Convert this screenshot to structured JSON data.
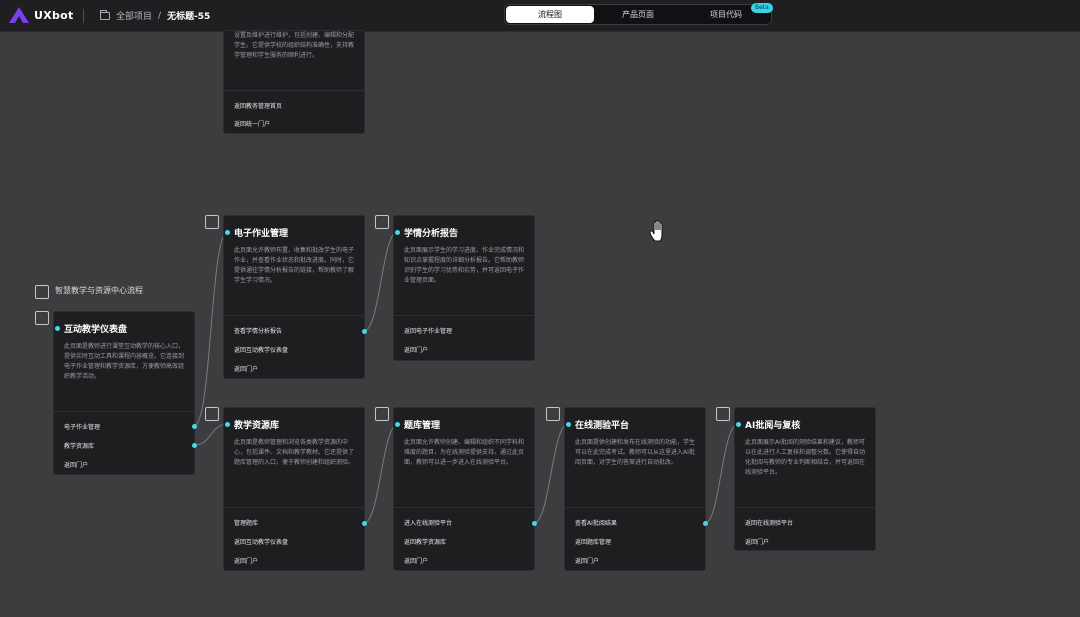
{
  "app": {
    "logo_text": "UXbot",
    "breadcrumb_root": "全部项目",
    "breadcrumb_sep": "/",
    "breadcrumb_current": "无标题-55"
  },
  "tabs": [
    {
      "label": "流程图",
      "active": true
    },
    {
      "label": "产品页面"
    },
    {
      "label": "项目代码"
    }
  ],
  "beta": "Beta",
  "flow_label": "智慧教学与资源中心流程",
  "colors": {
    "accent": "#46d7ef",
    "bg": "#3d3d3f",
    "node": "#1e1e21"
  },
  "nodes": {
    "top": {
      "desc": "设置及维护进行维护，包括创建、编辑和分配学生。它提供学校的组织结构准确性，支持教学管理和学生服务的顺利进行。",
      "links": [
        "返回教务管理首页",
        "返回统一门户"
      ]
    },
    "dashboard": {
      "title": "互动教学仪表盘",
      "desc": "此页面是教师进行课堂互动教学的核心入口，提供实时互动工具和课程内容概览。它连接到电子作业管理和教学资源库，方便教师高效组织教学活动。",
      "links": [
        "电子作业管理",
        "教学资源库",
        "返回门户"
      ]
    },
    "homework": {
      "title": "电子作业管理",
      "desc": "此页面允许教师布置、收集和批改学生的电子作业，并查看作业状态和批改进度。同时，它提供通往学情分析报告的链接，帮助教师了解学生学习情况。",
      "links": [
        "查看学情分析报告",
        "返回互动教学仪表盘",
        "返回门户"
      ]
    },
    "analysis": {
      "title": "学情分析报告",
      "desc": "此页面展示学生的学习进度、作业完成情况和知识点掌握程度的详细分析报告。它帮助教师识别学生的学习优势和劣势，并可返回电子作业管理页面。",
      "links": [
        "返回电子作业管理",
        "返回门户"
      ]
    },
    "resources": {
      "title": "教学资源库",
      "desc": "此页面是教师管理和浏览各类教学资源的中心，包括课件、文档和教学教材。它还提供了题库管理的入口，便于教师创建和组织测验。",
      "links": [
        "管理题库",
        "返回互动教学仪表盘",
        "返回门户"
      ]
    },
    "questions": {
      "title": "题库管理",
      "desc": "此页面允许教师创建、编辑和组织不同学科和难度的题目，为在线测验提供支持。通过此页面，教师可以进一步进入在线测验平台。",
      "links": [
        "进入在线测验平台",
        "返回教学资源库",
        "返回门户"
      ]
    },
    "quiz": {
      "title": "在线测验平台",
      "desc": "此页面提供创建和发布在线测验的功能，学生可以在此完成考试。教师可以从这里进入AI批阅页面，对学生的答案进行自动批改。",
      "links": [
        "查看AI批阅结果",
        "返回题库管理",
        "返回门户"
      ]
    },
    "ai": {
      "title": "AI批阅与复核",
      "desc": "此页面展示AI批阅的测验结果和建议，教师可以在此进行人工复核和调整分数。它使得自动化批阅与教师的专业判断相结合，并可返回在线测验平台。",
      "links": [
        "返回在线测验平台",
        "返回门户"
      ]
    }
  }
}
